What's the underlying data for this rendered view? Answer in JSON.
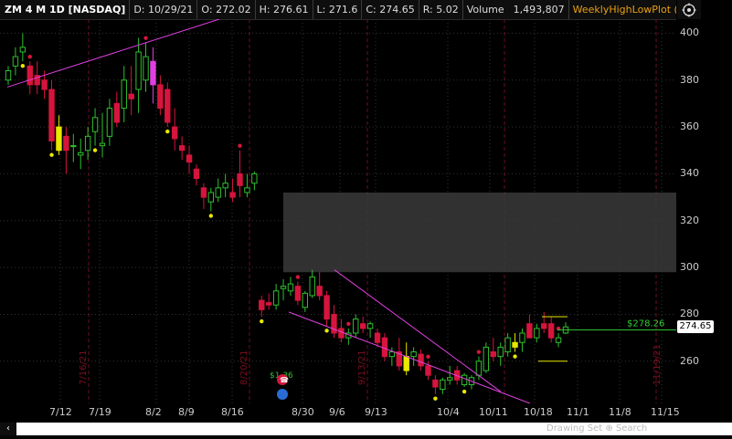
{
  "header": {
    "symbol": "ZM 4 M 1D [NASDAQ]",
    "date": "D: 10/29/21",
    "open": "O: 272.02",
    "high": "H: 276.61",
    "low": "L: 271.6",
    "close": "C: 274.65",
    "range": "R: 5.02",
    "volume_label": "Volume",
    "volume_value": "1,493,807",
    "study": "WeeklyHighLowPlot (WEEK,..."
  },
  "yaxis": {
    "ticks": [
      "400",
      "380",
      "360",
      "340",
      "320",
      "300",
      "280",
      "260"
    ],
    "min": 242,
    "max": 406,
    "current_price": "274.65"
  },
  "xaxis": {
    "ticks": [
      "7/12",
      "7/19",
      "8/2",
      "8/9",
      "8/16",
      "8/30",
      "9/6",
      "9/13",
      "10/4",
      "10/11",
      "10/18",
      "11/1",
      "11/8",
      "11/15"
    ]
  },
  "events": {
    "dividend_label": "$1.36",
    "rotated_dates": [
      "7/16/21",
      "8/20/21",
      "9/13/21",
      "11/19/21"
    ]
  },
  "weekly_high_label": "$278.26",
  "statusbar": {
    "scroll_left": "‹",
    "tools": "Drawing  Set  ⊕  Search"
  },
  "colors": {
    "up": "#2ec02e",
    "down": "#d6153d",
    "magenta": "#e040e0",
    "yellow": "#e8e800",
    "weekly_line": "#33cc33",
    "gap_fill": "#3a3a3a"
  },
  "chart_data": {
    "type": "candlestick",
    "candles": [
      {
        "o": 380,
        "h": 386,
        "l": 378,
        "c": 384
      },
      {
        "o": 386,
        "h": 394,
        "l": 382,
        "c": 390
      },
      {
        "o": 392,
        "h": 400,
        "l": 388,
        "c": 394
      },
      {
        "o": 386,
        "h": 388,
        "l": 374,
        "c": 378
      },
      {
        "o": 382,
        "h": 388,
        "l": 374,
        "c": 378
      },
      {
        "o": 380,
        "h": 384,
        "l": 372,
        "c": 376
      },
      {
        "o": 376,
        "h": 380,
        "l": 350,
        "c": 354
      },
      {
        "o": 360,
        "h": 365,
        "l": 348,
        "c": 350
      },
      {
        "o": 356,
        "h": 360,
        "l": 340,
        "c": 350
      },
      {
        "o": 352,
        "h": 357,
        "l": 345,
        "c": 352
      },
      {
        "o": 348,
        "h": 355,
        "l": 342,
        "c": 349
      },
      {
        "o": 350,
        "h": 360,
        "l": 346,
        "c": 356
      },
      {
        "o": 358,
        "h": 368,
        "l": 352,
        "c": 364
      },
      {
        "o": 352,
        "h": 366,
        "l": 347,
        "c": 353
      },
      {
        "o": 356,
        "h": 372,
        "l": 352,
        "c": 368
      },
      {
        "o": 370,
        "h": 375,
        "l": 360,
        "c": 362
      },
      {
        "o": 368,
        "h": 386,
        "l": 362,
        "c": 380
      },
      {
        "o": 374,
        "h": 386,
        "l": 365,
        "c": 372
      },
      {
        "o": 376,
        "h": 398,
        "l": 366,
        "c": 392
      },
      {
        "o": 380,
        "h": 396,
        "l": 375,
        "c": 390
      },
      {
        "o": 388,
        "h": 394,
        "l": 370,
        "c": 378
      },
      {
        "o": 378,
        "h": 382,
        "l": 365,
        "c": 368
      },
      {
        "o": 376,
        "h": 379,
        "l": 360,
        "c": 362
      },
      {
        "o": 360,
        "h": 368,
        "l": 350,
        "c": 355
      },
      {
        "o": 352,
        "h": 356,
        "l": 346,
        "c": 350
      },
      {
        "o": 348,
        "h": 352,
        "l": 340,
        "c": 345
      },
      {
        "o": 342,
        "h": 344,
        "l": 335,
        "c": 338
      },
      {
        "o": 334,
        "h": 336,
        "l": 325,
        "c": 330
      },
      {
        "o": 328,
        "h": 334,
        "l": 324,
        "c": 332
      },
      {
        "o": 330,
        "h": 338,
        "l": 328,
        "c": 334
      },
      {
        "o": 334,
        "h": 340,
        "l": 330,
        "c": 336
      },
      {
        "o": 332,
        "h": 338,
        "l": 328,
        "c": 330
      },
      {
        "o": 340,
        "h": 350,
        "l": 330,
        "c": 335
      },
      {
        "o": 332,
        "h": 340,
        "l": 330,
        "c": 334
      },
      {
        "o": 336,
        "h": 341,
        "l": 333,
        "c": 340
      },
      {
        "o": 286,
        "h": 288,
        "l": 279,
        "c": 282
      },
      {
        "o": 285,
        "h": 289,
        "l": 282,
        "c": 284
      },
      {
        "o": 284,
        "h": 293,
        "l": 282,
        "c": 290
      },
      {
        "o": 291,
        "h": 295,
        "l": 286,
        "c": 292
      },
      {
        "o": 290,
        "h": 296,
        "l": 288,
        "c": 293
      },
      {
        "o": 292,
        "h": 294,
        "l": 284,
        "c": 286
      },
      {
        "o": 283,
        "h": 290,
        "l": 281,
        "c": 289
      },
      {
        "o": 288,
        "h": 299,
        "l": 287,
        "c": 296
      },
      {
        "o": 292,
        "h": 298,
        "l": 286,
        "c": 288
      },
      {
        "o": 288,
        "h": 290,
        "l": 275,
        "c": 278
      },
      {
        "o": 280,
        "h": 284,
        "l": 270,
        "c": 272
      },
      {
        "o": 274,
        "h": 278,
        "l": 268,
        "c": 270
      },
      {
        "o": 270,
        "h": 274,
        "l": 267,
        "c": 272
      },
      {
        "o": 272,
        "h": 280,
        "l": 270,
        "c": 278
      },
      {
        "o": 276,
        "h": 279,
        "l": 272,
        "c": 274
      },
      {
        "o": 274,
        "h": 277,
        "l": 270,
        "c": 276
      },
      {
        "o": 272,
        "h": 274,
        "l": 266,
        "c": 268
      },
      {
        "o": 270,
        "h": 272,
        "l": 260,
        "c": 262
      },
      {
        "o": 262,
        "h": 266,
        "l": 258,
        "c": 264
      },
      {
        "o": 264,
        "h": 270,
        "l": 256,
        "c": 258
      },
      {
        "o": 262,
        "h": 268,
        "l": 254,
        "c": 256
      },
      {
        "o": 262,
        "h": 266,
        "l": 258,
        "c": 264
      },
      {
        "o": 263,
        "h": 265,
        "l": 256,
        "c": 258
      },
      {
        "o": 258,
        "h": 260,
        "l": 252,
        "c": 254
      },
      {
        "o": 252,
        "h": 254,
        "l": 246,
        "c": 249
      },
      {
        "o": 248,
        "h": 253,
        "l": 246,
        "c": 252
      },
      {
        "o": 252,
        "h": 258,
        "l": 250,
        "c": 253
      },
      {
        "o": 256,
        "h": 258,
        "l": 250,
        "c": 252
      },
      {
        "o": 250,
        "h": 255,
        "l": 249,
        "c": 254
      },
      {
        "o": 250,
        "h": 254,
        "l": 248,
        "c": 253
      },
      {
        "o": 254,
        "h": 262,
        "l": 252,
        "c": 260
      },
      {
        "o": 256,
        "h": 268,
        "l": 255,
        "c": 266
      },
      {
        "o": 264,
        "h": 270,
        "l": 260,
        "c": 262
      },
      {
        "o": 262,
        "h": 268,
        "l": 258,
        "c": 266
      },
      {
        "o": 264,
        "h": 272,
        "l": 262,
        "c": 270
      },
      {
        "o": 268,
        "h": 272,
        "l": 264,
        "c": 266
      },
      {
        "o": 268,
        "h": 274,
        "l": 264,
        "c": 272
      },
      {
        "o": 276,
        "h": 280,
        "l": 272,
        "c": 270
      },
      {
        "o": 270,
        "h": 276,
        "l": 268,
        "c": 274
      },
      {
        "o": 276,
        "h": 281,
        "l": 272,
        "c": 274
      },
      {
        "o": 276,
        "h": 279,
        "l": 268,
        "c": 270
      },
      {
        "o": 268,
        "h": 272,
        "l": 266,
        "c": 270
      },
      {
        "o": 272.02,
        "h": 276.61,
        "l": 271.6,
        "c": 274.65
      }
    ]
  }
}
